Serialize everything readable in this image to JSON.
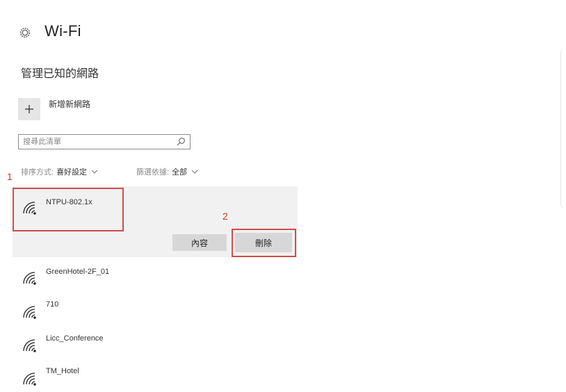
{
  "header": {
    "title": "Wi-Fi",
    "icon": "gear-icon"
  },
  "section_title": "管理已知的網路",
  "add_network": {
    "label": "新增新網路",
    "icon": "plus-icon"
  },
  "search": {
    "placeholder": "搜尋此清單",
    "icon": "search-icon"
  },
  "filters": {
    "sort_label": "排序方式:",
    "sort_value": "喜好設定",
    "filter_label": "篩選依據:",
    "filter_value": "全部"
  },
  "steps": {
    "one": "1",
    "two": "2"
  },
  "selected_network": {
    "name": "NTPU-802.1x",
    "properties_label": "內容",
    "forget_label": "刪除"
  },
  "networks": [
    {
      "name": "GreenHotel-2F_01"
    },
    {
      "name": "710"
    },
    {
      "name": "Licc_Conference"
    },
    {
      "name": "TM_Hotel"
    }
  ],
  "colors": {
    "highlight": "#d34b4b",
    "step_text": "#d0341c",
    "selected_bg": "#f1f1f1",
    "button_bg": "#d7d7d7"
  }
}
